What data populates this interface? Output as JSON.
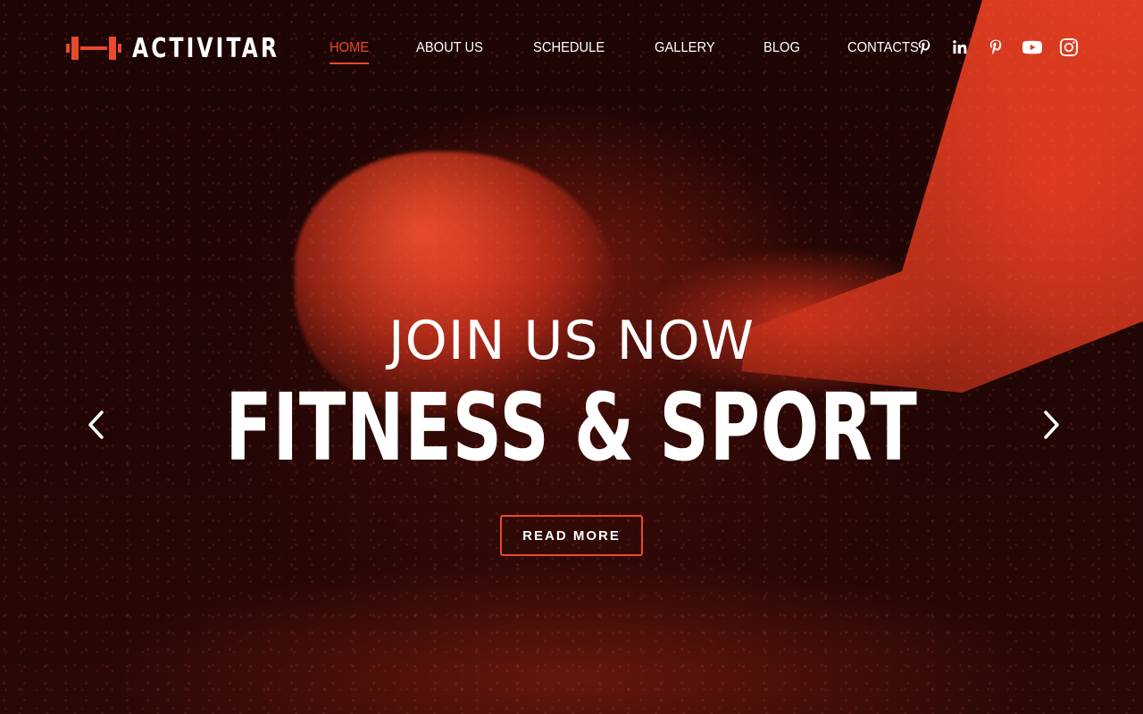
{
  "brand": {
    "name": "ACTIVITAR",
    "icon": "dumbbell-icon",
    "accent_color": "#e94a2b"
  },
  "nav": {
    "items": [
      {
        "label": "HOME",
        "active": true
      },
      {
        "label": "ABOUT US",
        "active": false
      },
      {
        "label": "SCHEDULE",
        "active": false
      },
      {
        "label": "GALLERY",
        "active": false
      },
      {
        "label": "BLOG",
        "active": false
      },
      {
        "label": "CONTACTS",
        "active": false
      }
    ]
  },
  "social": [
    "pinterest-icon",
    "linkedin-icon",
    "pinterest-icon",
    "youtube-icon",
    "instagram-icon"
  ],
  "hero": {
    "subtitle": "JOIN US NOW",
    "title": "FITNESS & SPORT",
    "button_label": "READ MORE",
    "prev_icon": "chevron-left-icon",
    "next_icon": "chevron-right-icon"
  }
}
